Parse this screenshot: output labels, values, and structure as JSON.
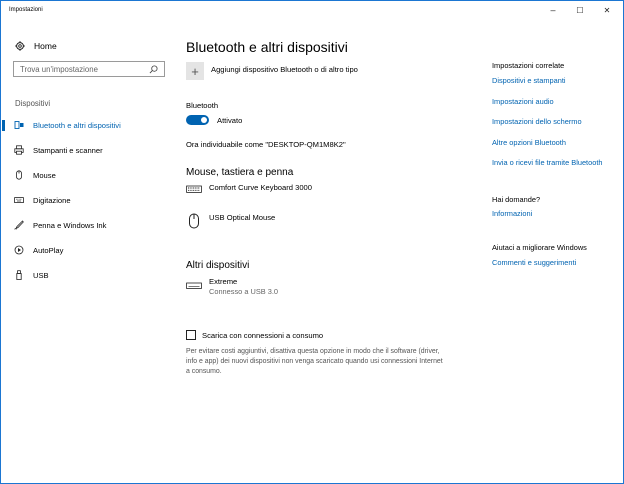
{
  "window": {
    "title": "Impostazioni",
    "minimize_glyph": "–",
    "maximize_glyph": "☐",
    "close_glyph": "✕"
  },
  "sidebar": {
    "home_label": "Home",
    "search_placeholder": "Trova un'impostazione",
    "section_label": "Dispositivi",
    "items": [
      {
        "label": "Bluetooth e altri dispositivi",
        "icon": "bluetooth-devices-icon",
        "active": true
      },
      {
        "label": "Stampanti e scanner",
        "icon": "printer-icon",
        "active": false
      },
      {
        "label": "Mouse",
        "icon": "mouse-icon",
        "active": false
      },
      {
        "label": "Digitazione",
        "icon": "keyboard-icon",
        "active": false
      },
      {
        "label": "Penna e Windows Ink",
        "icon": "pen-icon",
        "active": false
      },
      {
        "label": "AutoPlay",
        "icon": "autoplay-icon",
        "active": false
      },
      {
        "label": "USB",
        "icon": "usb-icon",
        "active": false
      }
    ]
  },
  "main": {
    "title": "Bluetooth e altri dispositivi",
    "add_device_label": "Aggiungi dispositivo Bluetooth o di altro tipo",
    "bluetooth_label": "Bluetooth",
    "bluetooth_state": "Attivato",
    "bluetooth_on": true,
    "discoverable_text": "Ora individuabile come \"DESKTOP-QM1M8K2\"",
    "mouse_section_title": "Mouse, tastiera e penna",
    "mouse_devices": [
      {
        "name": "Comfort Curve Keyboard 3000",
        "icon": "keyboard-icon"
      },
      {
        "name": "USB Optical Mouse",
        "icon": "mouse-icon"
      }
    ],
    "other_section_title": "Altri dispositivi",
    "other_devices": [
      {
        "name": "Extreme",
        "status": "Connesso a USB 3.0",
        "icon": "usb-drive-icon"
      }
    ],
    "metered_checkbox_label": "Scarica con connessioni a consumo",
    "metered_checked": false,
    "metered_description": "Per evitare costi aggiuntivi, disattiva questa opzione in modo che il software (driver, info e app) dei nuovi dispositivi non venga scaricato quando usi connessioni Internet a consumo."
  },
  "related": {
    "heading": "Impostazioni correlate",
    "links": [
      "Dispositivi e stampanti",
      "Impostazioni audio",
      "Impostazioni dello schermo",
      "Altre opzioni Bluetooth",
      "Invia o ricevi file tramite Bluetooth"
    ],
    "questions_heading": "Hai domande?",
    "questions_link": "Informazioni",
    "improve_heading": "Aiutaci a migliorare Windows",
    "improve_link": "Commenti e suggerimenti"
  },
  "colors": {
    "accent": "#0063b1",
    "window_border": "#1b76d2"
  }
}
